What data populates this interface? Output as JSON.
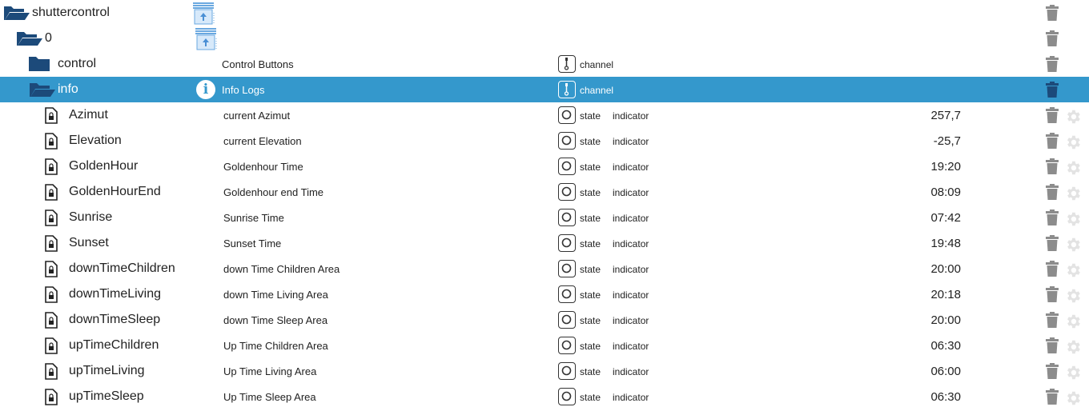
{
  "colors": {
    "selected_row": "#3498cc",
    "folder": "#1c4a7a",
    "trash": "#8c8c8c"
  },
  "tree": [
    {
      "name": "shuttercontrol",
      "level": 0,
      "kind": "folder-open",
      "icon": "shutter-icon"
    },
    {
      "name": "0",
      "level": 1,
      "kind": "folder-open",
      "icon": "shutter-icon"
    },
    {
      "name": "control",
      "level": 2,
      "kind": "folder",
      "desc": "Control Buttons",
      "type": "channel"
    },
    {
      "name": "info",
      "level": 2,
      "kind": "folder-open",
      "desc": "Info Logs",
      "type": "channel",
      "selected": true,
      "icon": "info-icon"
    },
    {
      "name": "Azimut",
      "level": 3,
      "kind": "state",
      "desc": "current Azimut",
      "type": "state",
      "role": "indicator",
      "value": "257,7"
    },
    {
      "name": "Elevation",
      "level": 3,
      "kind": "state",
      "desc": "current Elevation",
      "type": "state",
      "role": "indicator",
      "value": "-25,7"
    },
    {
      "name": "GoldenHour",
      "level": 3,
      "kind": "state",
      "desc": "Goldenhour Time",
      "type": "state",
      "role": "indicator",
      "value": "19:20"
    },
    {
      "name": "GoldenHourEnd",
      "level": 3,
      "kind": "state",
      "desc": "Goldenhour end Time",
      "type": "state",
      "role": "indicator",
      "value": "08:09"
    },
    {
      "name": "Sunrise",
      "level": 3,
      "kind": "state",
      "desc": "Sunrise Time",
      "type": "state",
      "role": "indicator",
      "value": "07:42"
    },
    {
      "name": "Sunset",
      "level": 3,
      "kind": "state",
      "desc": "Sunset Time",
      "type": "state",
      "role": "indicator",
      "value": "19:48"
    },
    {
      "name": "downTimeChildren",
      "level": 3,
      "kind": "state",
      "desc": "down Time Children Area",
      "type": "state",
      "role": "indicator",
      "value": "20:00"
    },
    {
      "name": "downTimeLiving",
      "level": 3,
      "kind": "state",
      "desc": "down Time Living Area",
      "type": "state",
      "role": "indicator",
      "value": "20:18"
    },
    {
      "name": "downTimeSleep",
      "level": 3,
      "kind": "state",
      "desc": "down Time Sleep Area",
      "type": "state",
      "role": "indicator",
      "value": "20:00"
    },
    {
      "name": "upTimeChildren",
      "level": 3,
      "kind": "state",
      "desc": "Up Time Children Area",
      "type": "state",
      "role": "indicator",
      "value": "06:30"
    },
    {
      "name": "upTimeLiving",
      "level": 3,
      "kind": "state",
      "desc": "Up Time Living Area",
      "type": "state",
      "role": "indicator",
      "value": "06:00"
    },
    {
      "name": "upTimeSleep",
      "level": 3,
      "kind": "state",
      "desc": "Up Time Sleep Area",
      "type": "state",
      "role": "indicator",
      "value": "06:30"
    }
  ]
}
